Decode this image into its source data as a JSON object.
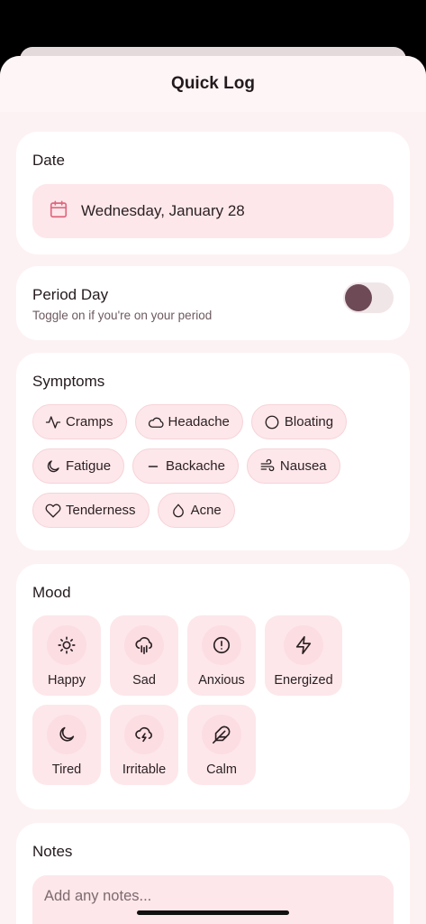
{
  "header": {
    "title": "Quick Log"
  },
  "date": {
    "title": "Date",
    "value": "Wednesday, January 28",
    "icon": "calendar-icon"
  },
  "period": {
    "title": "Period Day",
    "subtitle": "Toggle on if you're on your period",
    "enabled": false
  },
  "symptoms": {
    "title": "Symptoms",
    "items": [
      {
        "label": "Cramps",
        "icon": "activity-icon"
      },
      {
        "label": "Headache",
        "icon": "cloud-icon"
      },
      {
        "label": "Bloating",
        "icon": "circle-icon"
      },
      {
        "label": "Fatigue",
        "icon": "moon-icon"
      },
      {
        "label": "Backache",
        "icon": "minus-icon"
      },
      {
        "label": "Nausea",
        "icon": "wind-icon"
      },
      {
        "label": "Tenderness",
        "icon": "heart-icon"
      },
      {
        "label": "Acne",
        "icon": "droplet-icon"
      }
    ]
  },
  "mood": {
    "title": "Mood",
    "items": [
      {
        "label": "Happy",
        "icon": "sun-icon"
      },
      {
        "label": "Sad",
        "icon": "cloud-rain-icon"
      },
      {
        "label": "Anxious",
        "icon": "alert-circle-icon"
      },
      {
        "label": "Energized",
        "icon": "zap-icon"
      },
      {
        "label": "Tired",
        "icon": "moon-icon"
      },
      {
        "label": "Irritable",
        "icon": "cloud-lightning-icon"
      },
      {
        "label": "Calm",
        "icon": "feather-icon"
      }
    ]
  },
  "notes": {
    "title": "Notes",
    "placeholder": "Add any notes..."
  },
  "colors": {
    "accent": "#6e4a57",
    "chip_bg": "#fde7ea",
    "sheet_bg": "#fdf2f3",
    "calendar_icon": "#e0667e"
  }
}
